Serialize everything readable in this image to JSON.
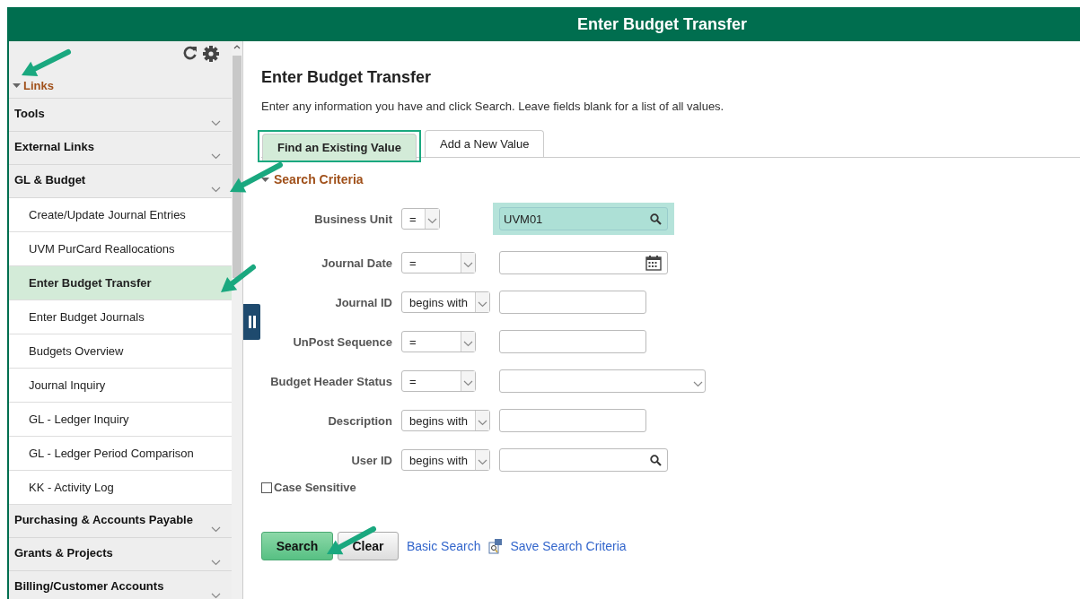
{
  "header": {
    "title": "Enter Budget Transfer"
  },
  "sidebar": {
    "section": {
      "label": "Links",
      "expanded": true
    },
    "items": [
      {
        "label": "Tools"
      },
      {
        "label": "External Links"
      },
      {
        "label": "GL & Budget",
        "children": [
          {
            "label": "Create/Update Journal Entries",
            "selected": false
          },
          {
            "label": "UVM PurCard Reallocations",
            "selected": false
          },
          {
            "label": "Enter Budget Transfer",
            "selected": true
          },
          {
            "label": "Enter Budget Journals",
            "selected": false
          },
          {
            "label": "Budgets Overview",
            "selected": false
          },
          {
            "label": "Journal Inquiry",
            "selected": false
          },
          {
            "label": "GL - Ledger Inquiry",
            "selected": false
          },
          {
            "label": "GL - Ledger Period Comparison",
            "selected": false
          },
          {
            "label": "KK - Activity Log",
            "selected": false
          }
        ]
      },
      {
        "label": "Purchasing & Accounts Payable"
      },
      {
        "label": "Grants & Projects"
      },
      {
        "label": "Billing/Customer Accounts"
      }
    ]
  },
  "page": {
    "title": "Enter Budget Transfer",
    "instructions": "Enter any information you have and click Search. Leave fields blank for a list of all values."
  },
  "tabs": [
    {
      "label": "Find an Existing Value",
      "selected": true,
      "highlighted": true
    },
    {
      "label": "Add a New Value",
      "selected": false,
      "highlighted": false
    }
  ],
  "search_criteria": {
    "label": "Search Criteria",
    "expanded": true,
    "fields": [
      {
        "label": "Business Unit",
        "operator": "=",
        "compact": true,
        "kind": "lookup",
        "value": "UVM01",
        "highlighted": true
      },
      {
        "label": "Journal Date",
        "operator": "=",
        "compact": false,
        "kind": "date",
        "highlighted": false
      },
      {
        "label": "Journal ID",
        "operator": "begins with",
        "compact": false,
        "kind": "text",
        "highlighted": false
      },
      {
        "label": "UnPost Sequence",
        "operator": "=",
        "compact": false,
        "kind": "text",
        "highlighted": false
      },
      {
        "label": "Budget Header Status",
        "operator": "=",
        "compact": false,
        "kind": "dropdown",
        "highlighted": false
      },
      {
        "label": "Description",
        "operator": "begins with",
        "compact": false,
        "kind": "text",
        "highlighted": false
      },
      {
        "label": "User ID",
        "operator": "begins with",
        "compact": false,
        "kind": "lookup",
        "highlighted": false
      }
    ],
    "case_sensitive": {
      "label": "Case Sensitive",
      "checked": false
    }
  },
  "actions": {
    "buttons": [
      {
        "label": "Search",
        "kind": "primary"
      },
      {
        "label": "Clear",
        "kind": "secondary"
      }
    ],
    "links": [
      {
        "label": "Basic Search",
        "kind": "plain"
      },
      {
        "label": "Save Search Criteria",
        "kind": "save"
      }
    ]
  }
}
